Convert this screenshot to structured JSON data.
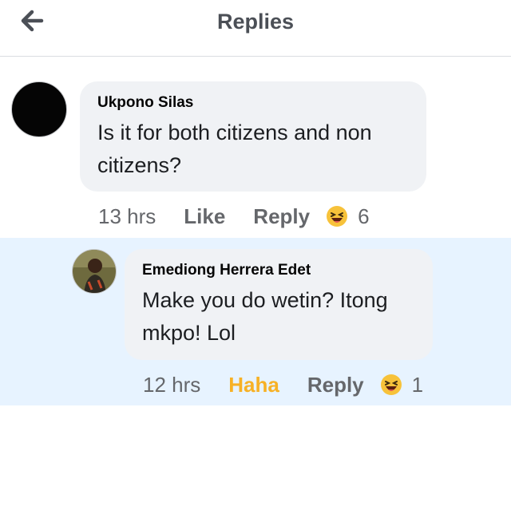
{
  "header": {
    "title": "Replies",
    "back_icon": "arrow-left-icon"
  },
  "comments": [
    {
      "author": "Ukpono Silas",
      "text": "Is it for both citizens and non citizens?",
      "time": "13 hrs",
      "like_label": "Like",
      "reply_label": "Reply",
      "reaction_icon": "haha-emoji-icon",
      "reaction_count": "6"
    },
    {
      "author": "Emediong Herrera Edet",
      "text": "Make you do wetin? Itong mkpo! Lol",
      "time": "12 hrs",
      "like_label": "Haha",
      "reply_label": "Reply",
      "reaction_icon": "haha-emoji-icon",
      "reaction_count": "1"
    }
  ],
  "colors": {
    "reaction_active": "#f7b125",
    "highlight_bg": "#e7f3ff",
    "bubble_bg": "#f0f2f5"
  }
}
